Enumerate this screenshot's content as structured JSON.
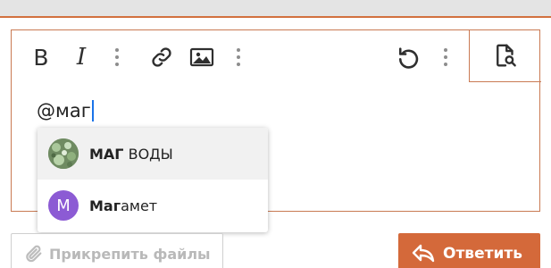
{
  "editor": {
    "toolbar": {
      "bold_glyph": "B",
      "italic_glyph": "I"
    },
    "text_value": "@маг"
  },
  "mention_dropdown": {
    "items": [
      {
        "match": "МАГ",
        "rest": " ВОДЫ",
        "avatar": "photo",
        "highlighted": true
      },
      {
        "match": "Маг",
        "rest": "амет",
        "avatar": "letter",
        "avatar_letter": "M",
        "highlighted": false
      }
    ]
  },
  "footer": {
    "attach_label": "Прикрепить файлы",
    "reply_label": "Ответить"
  },
  "colors": {
    "accent": "#d4693a",
    "border": "#c97a53",
    "avatar_purple": "#8c5bd4",
    "caret": "#1a73e8"
  },
  "icons": [
    "bold-icon",
    "italic-icon",
    "more-icon",
    "link-icon",
    "image-icon",
    "undo-icon",
    "preview-icon",
    "paperclip-icon",
    "reply-arrow-icon"
  ]
}
